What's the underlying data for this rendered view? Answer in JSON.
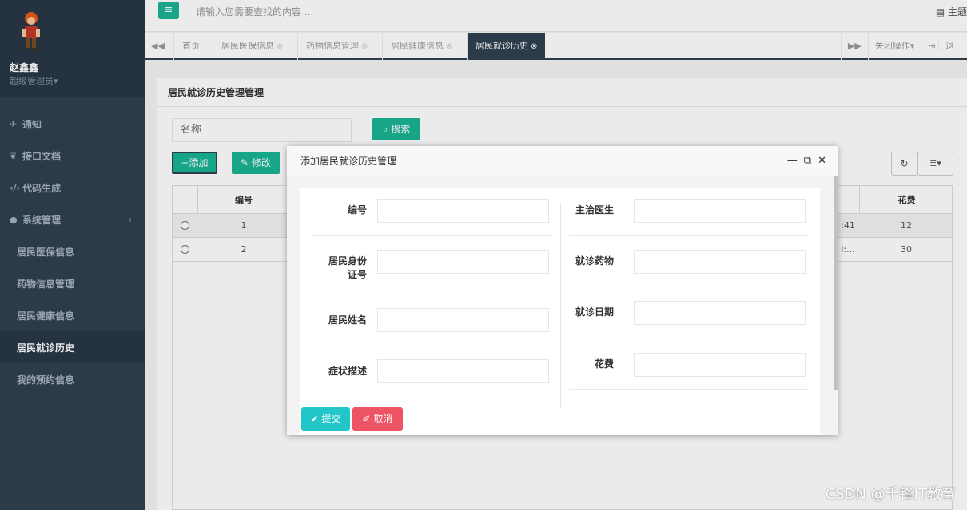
{
  "user": {
    "name": "赵鑫鑫",
    "role": "超级管理员▾"
  },
  "sidebar": {
    "items": [
      {
        "icon": "paper-plane-icon",
        "label": "通知"
      },
      {
        "icon": "leaf-icon",
        "label": "接口文档"
      },
      {
        "icon": "code-icon",
        "label": "代码生成"
      },
      {
        "icon": "user-icon",
        "label": "系统管理",
        "caret": "‹"
      }
    ],
    "subitems": [
      {
        "label": "居民医保信息"
      },
      {
        "label": "药物信息管理"
      },
      {
        "label": "居民健康信息"
      },
      {
        "label": "居民就诊历史",
        "active": true
      },
      {
        "label": "我的预约信息"
      }
    ]
  },
  "topbar": {
    "menu_icon": "≡",
    "search_placeholder": "请输入您需要查找的内容 ...",
    "theme_label": "主题"
  },
  "tabs": {
    "items": [
      {
        "label": "首页"
      },
      {
        "label": "居民医保信息"
      },
      {
        "label": "药物信息管理"
      },
      {
        "label": "居民健康信息"
      },
      {
        "label": "居民就诊历史"
      }
    ],
    "close_ops": "关闭操作▾",
    "logout": "退"
  },
  "panel": {
    "title": "居民就诊历史管理管理",
    "filter_label": "名称",
    "search_button": "搜索",
    "add_button": "添加",
    "edit_button": "修改"
  },
  "table": {
    "headers": {
      "id": "编号",
      "cost": "花费"
    },
    "rows": [
      {
        "id": "1",
        "date": ":41",
        "cost": "12"
      },
      {
        "id": "2",
        "date": "l:...",
        "cost": "30"
      }
    ]
  },
  "modal": {
    "title": "添加居民就诊历史管理",
    "fields_left": [
      {
        "label": "编号"
      },
      {
        "label": "居民身份证号",
        "line1": "居民身份",
        "line2": "证号"
      },
      {
        "label": "居民姓名"
      },
      {
        "label": "症状描述"
      }
    ],
    "fields_right": [
      {
        "label": "主治医生"
      },
      {
        "label": "就诊药物"
      },
      {
        "label": "就诊日期"
      },
      {
        "label": "花费"
      }
    ],
    "submit": "提交",
    "cancel": "取消"
  },
  "watermark": "CSDN @千锋IT教育"
}
